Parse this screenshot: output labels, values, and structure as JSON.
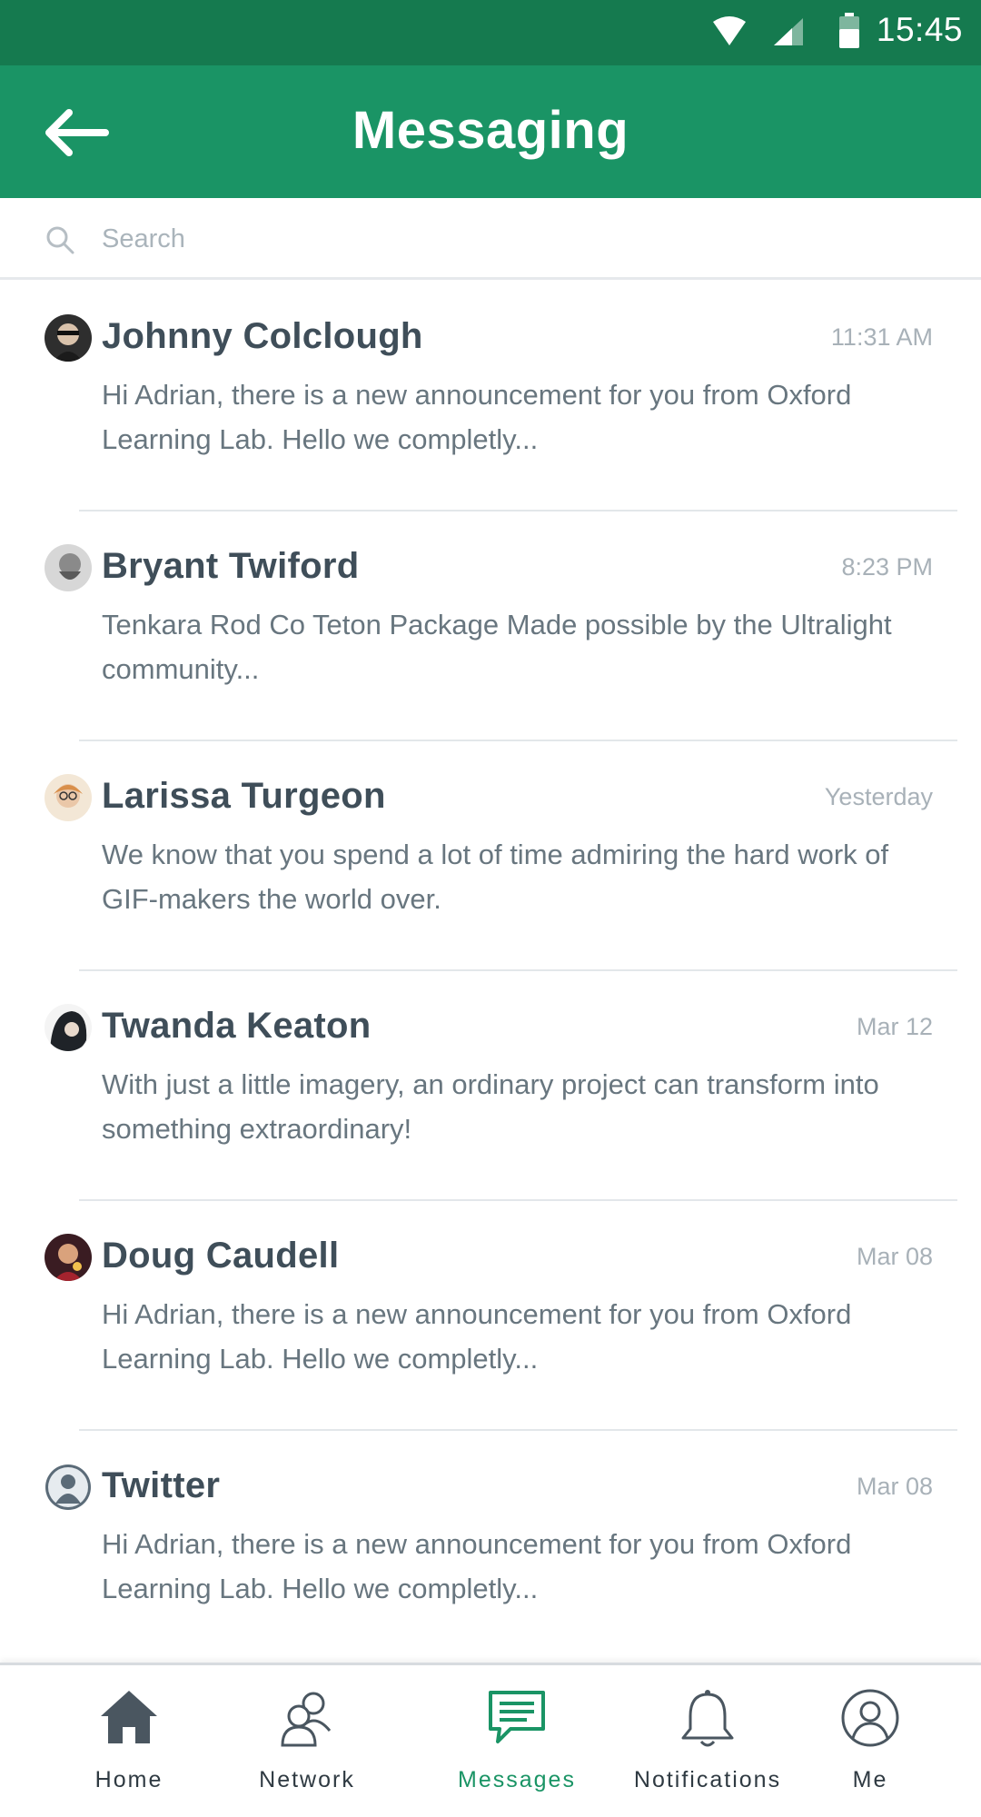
{
  "status_bar": {
    "time": "15:45"
  },
  "header": {
    "title": "Messaging"
  },
  "search": {
    "placeholder": "Search"
  },
  "conversations": [
    {
      "name": "Johnny Colclough",
      "time": "11:31 AM",
      "preview": "Hi Adrian, there is a new announcement for you from Oxford Learning  Lab. Hello we completly...",
      "avatar": "person-avatar"
    },
    {
      "name": "Bryant Twiford",
      "time": "8:23 PM",
      "preview": "Tenkara Rod Co Teton Package Made possible by the Ultralight community...",
      "avatar": "person-avatar"
    },
    {
      "name": "Larissa Turgeon",
      "time": "Yesterday",
      "preview": "We know that you spend a lot of time admiring the hard work of GIF-makers the world over.",
      "avatar": "person-avatar"
    },
    {
      "name": "Twanda Keaton",
      "time": "Mar 12",
      "preview": "With just a little imagery, an ordinary project can transform into something extraordinary!",
      "avatar": "person-avatar"
    },
    {
      "name": "Doug Caudell",
      "time": "Mar 08",
      "preview": "Hi Adrian, there is a new announcement for you from Oxford Learning  Lab. Hello we completly...",
      "avatar": "person-avatar"
    },
    {
      "name": "Twitter",
      "time": "Mar 08",
      "preview": "Hi Adrian, there is a new announcement for you from Oxford Learning  Lab. Hello we completly...",
      "avatar": "default-user-icon"
    }
  ],
  "bottom_nav": {
    "items": [
      {
        "label": "Home",
        "icon": "home-icon"
      },
      {
        "label": "Network",
        "icon": "network-icon"
      },
      {
        "label": "Messages",
        "icon": "messages-icon",
        "active": true
      },
      {
        "label": "Notifications",
        "icon": "bell-icon"
      },
      {
        "label": "Me",
        "icon": "profile-icon"
      }
    ]
  },
  "colors": {
    "status_bar": "#157a4f",
    "app_bar": "#1a9465",
    "accent": "#1a9465",
    "text": "#3f4e59"
  }
}
